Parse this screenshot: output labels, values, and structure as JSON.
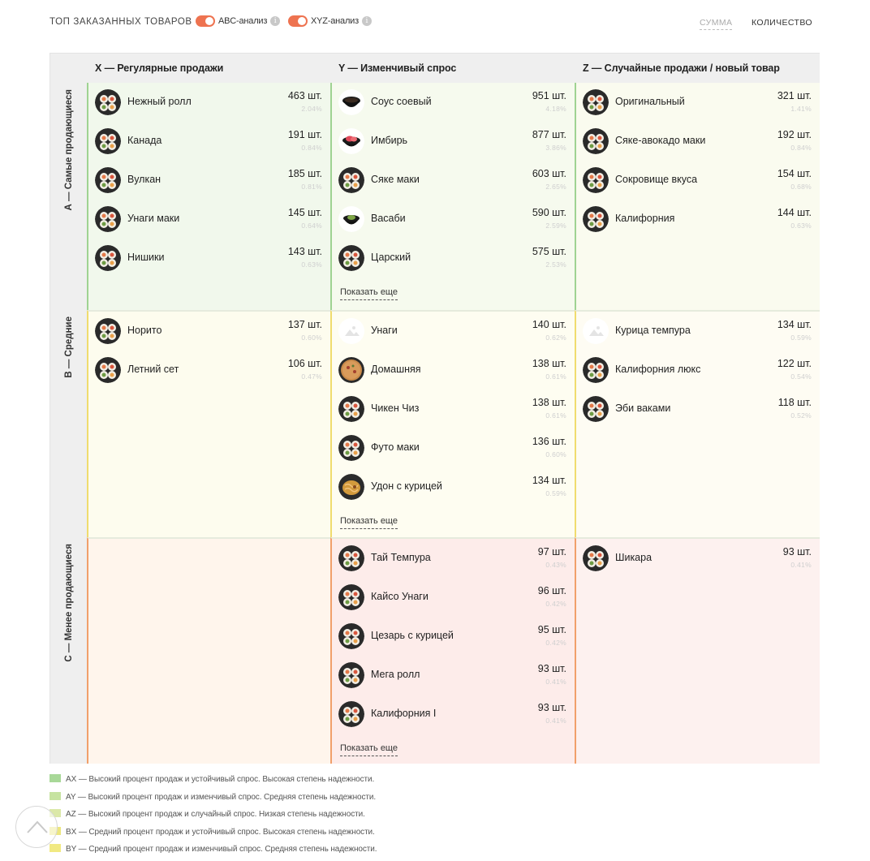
{
  "header": {
    "title": "ТОП ЗАКАЗАННЫХ ТОВАРОВ",
    "abc_label": "ABC-анализ",
    "xyz_label": "XYZ-анализ",
    "info_glyph": "i",
    "mode_sum": "СУММА",
    "mode_qty": "КОЛИЧЕСТВО"
  },
  "columns": [
    {
      "label": "X — Регулярные продажи"
    },
    {
      "label": "Y — Изменчивый спрос"
    },
    {
      "label": "Z — Случайные продажи / новый товар"
    }
  ],
  "rows": [
    {
      "label": "А — Самые продающиеся"
    },
    {
      "label": "В — Средние"
    },
    {
      "label": "С — Менее продающиеся"
    }
  ],
  "show_more_label": "Показать еще",
  "colors": {
    "accent": "#ee7350",
    "AX": "#f1f8ec",
    "AY": "#f6faee",
    "AZ": "#fafbef",
    "BX": "#fdfcee",
    "BY": "#fefdf1",
    "BZ": "#fefcf3",
    "CX": "#fff5ec",
    "CY": "#fdecea",
    "CZ": "#fdf1ef"
  },
  "cells": {
    "AX": {
      "items": [
        {
          "name": "Нежный ролл",
          "qty": "463 шт.",
          "pct": "2.04%",
          "icon": "roll-icon"
        },
        {
          "name": "Канада",
          "qty": "191 шт.",
          "pct": "0.84%",
          "icon": "roll-icon"
        },
        {
          "name": "Вулкан",
          "qty": "185 шт.",
          "pct": "0.81%",
          "icon": "roll-icon"
        },
        {
          "name": "Унаги маки",
          "qty": "145 шт.",
          "pct": "0.64%",
          "icon": "roll-icon"
        },
        {
          "name": "Нишики",
          "qty": "143 шт.",
          "pct": "0.63%",
          "icon": "roll-icon"
        }
      ]
    },
    "AY": {
      "items": [
        {
          "name": "Соус соевый",
          "qty": "951 шт.",
          "pct": "4.18%",
          "icon": "sauce-icon"
        },
        {
          "name": "Имбирь",
          "qty": "877 шт.",
          "pct": "3.86%",
          "icon": "ginger-icon"
        },
        {
          "name": "Сяке маки",
          "qty": "603 шт.",
          "pct": "2.65%",
          "icon": "roll-icon"
        },
        {
          "name": "Васаби",
          "qty": "590 шт.",
          "pct": "2.59%",
          "icon": "wasabi-icon"
        },
        {
          "name": "Царский",
          "qty": "575 шт.",
          "pct": "2.53%",
          "icon": "roll-icon"
        }
      ],
      "more": true
    },
    "AZ": {
      "items": [
        {
          "name": "Оригинальный",
          "qty": "321 шт.",
          "pct": "1.41%",
          "icon": "roll-icon"
        },
        {
          "name": "Сяке-авокадо маки",
          "qty": "192 шт.",
          "pct": "0.84%",
          "icon": "roll-icon"
        },
        {
          "name": "Сокровище вкуса",
          "qty": "154 шт.",
          "pct": "0.68%",
          "icon": "roll-icon"
        },
        {
          "name": "Калифорния",
          "qty": "144 шт.",
          "pct": "0.63%",
          "icon": "roll-icon"
        }
      ]
    },
    "BX": {
      "items": [
        {
          "name": "Норито",
          "qty": "137 шт.",
          "pct": "0.60%",
          "icon": "roll-icon"
        },
        {
          "name": "Летний сет",
          "qty": "106 шт.",
          "pct": "0.47%",
          "icon": "roll-icon"
        }
      ]
    },
    "BY": {
      "items": [
        {
          "name": "Унаги",
          "qty": "140 шт.",
          "pct": "0.62%",
          "icon": "image-placeholder-icon"
        },
        {
          "name": "Домашняя",
          "qty": "138 шт.",
          "pct": "0.61%",
          "icon": "pizza-icon"
        },
        {
          "name": "Чикен Чиз",
          "qty": "138 шт.",
          "pct": "0.61%",
          "icon": "roll-icon"
        },
        {
          "name": "Футо маки",
          "qty": "136 шт.",
          "pct": "0.60%",
          "icon": "roll-icon"
        },
        {
          "name": "Удон с курицей",
          "qty": "134 шт.",
          "pct": "0.59%",
          "icon": "noodles-icon"
        }
      ],
      "more": true
    },
    "BZ": {
      "items": [
        {
          "name": "Курица темпура",
          "qty": "134 шт.",
          "pct": "0.59%",
          "icon": "image-placeholder-icon"
        },
        {
          "name": "Калифорния люкс",
          "qty": "122 шт.",
          "pct": "0.54%",
          "icon": "roll-icon"
        },
        {
          "name": "Эби ваками",
          "qty": "118 шт.",
          "pct": "0.52%",
          "icon": "roll-icon"
        }
      ]
    },
    "CX": {
      "items": []
    },
    "CY": {
      "items": [
        {
          "name": "Тай Темпура",
          "qty": "97 шт.",
          "pct": "0.43%",
          "icon": "roll-icon"
        },
        {
          "name": "Кайсо Унаги",
          "qty": "96 шт.",
          "pct": "0.42%",
          "icon": "roll-icon"
        },
        {
          "name": "Цезарь с курицей",
          "qty": "95 шт.",
          "pct": "0.42%",
          "icon": "roll-icon"
        },
        {
          "name": "Мега ролл",
          "qty": "93 шт.",
          "pct": "0.41%",
          "icon": "roll-icon"
        },
        {
          "name": "Калифорния I",
          "qty": "93 шт.",
          "pct": "0.41%",
          "icon": "roll-icon"
        }
      ],
      "more": true
    },
    "CZ": {
      "items": [
        {
          "name": "Шикара",
          "qty": "93 шт.",
          "pct": "0.41%",
          "icon": "roll-icon"
        }
      ]
    }
  },
  "legend": [
    {
      "text": "AX — Высокий процент продаж и устойчивый спрос. Высокая степень надежности.",
      "color": "#a8d898"
    },
    {
      "text": "AY — Высокий процент продаж и изменчивый спрос. Средняя степень надежности.",
      "color": "#c6e3a0"
    },
    {
      "text": "AZ — Высокий процент продаж и случайный спрос. Низкая степень надежности.",
      "color": "#dbe8a8"
    },
    {
      "text": "BX — Средний процент продаж и устойчивый спрос. Высокая степень надежности.",
      "color": "#ece67e"
    },
    {
      "text": "BY — Средний процент продаж и изменчивый спрос. Средняя степень надежности.",
      "color": "#f1e982"
    }
  ]
}
